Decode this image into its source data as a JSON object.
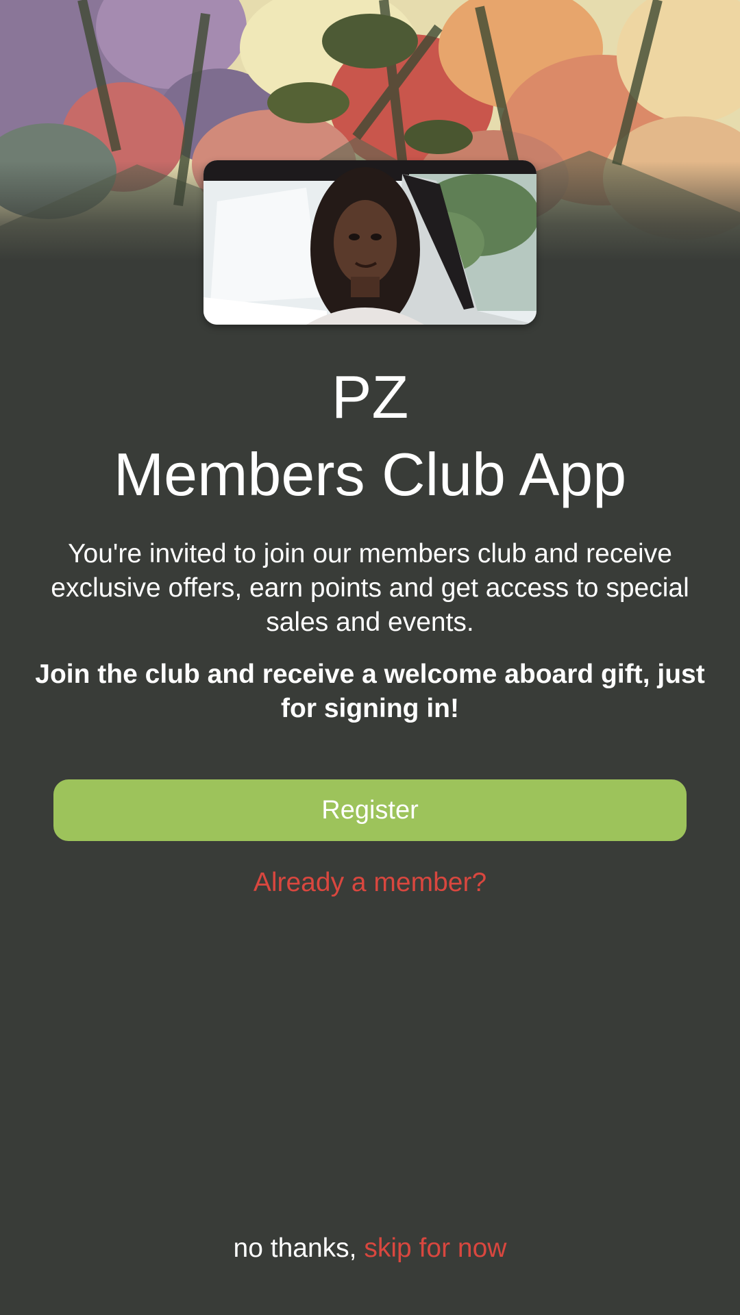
{
  "header": {
    "background_image": "flowers-background-image",
    "profile_photo": "member-photo-image"
  },
  "title": {
    "brand": "PZ",
    "app_name": "Members Club App"
  },
  "intro": {
    "invite_text": "You're invited to join our members club and receive exclusive offers, earn points and get access to special sales and events.",
    "gift_text": "Join the club and receive a welcome aboard gift, just for signing in!"
  },
  "actions": {
    "register_label": "Register",
    "already_member_label": "Already a member?",
    "no_thanks_label": "no thanks,",
    "skip_label": "skip for now"
  },
  "colors": {
    "background": "#393c38",
    "register_button": "#9dc35b",
    "link": "#d9473f",
    "text": "#ffffff"
  }
}
